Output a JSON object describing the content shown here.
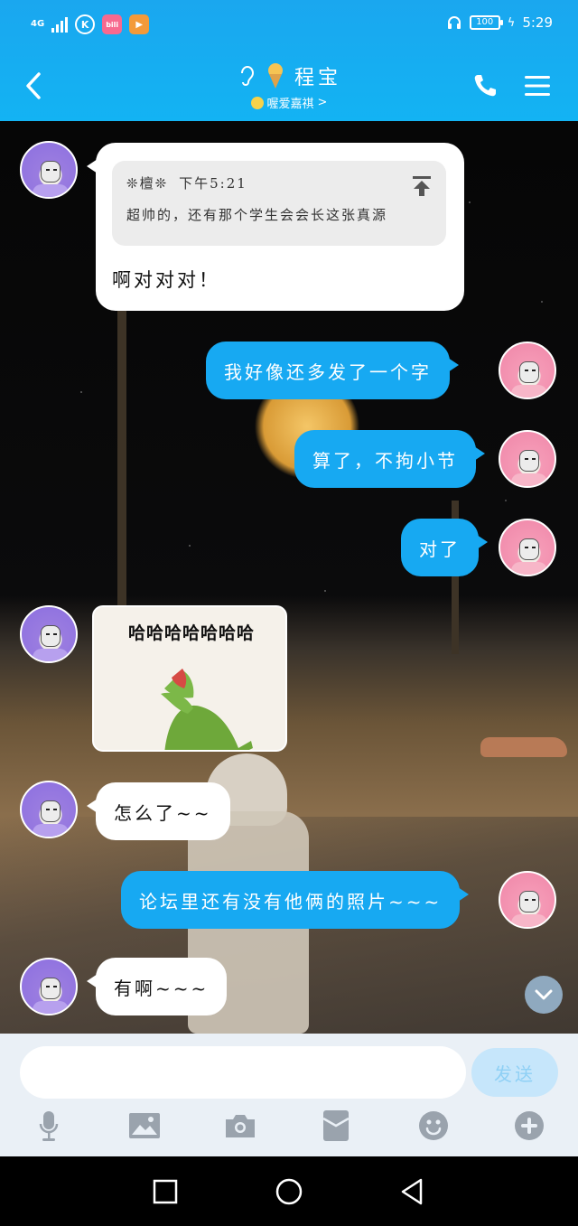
{
  "status_bar": {
    "network": "4G",
    "battery": "100",
    "time": "5:29",
    "apps": [
      "K",
      "bili",
      "▶"
    ]
  },
  "header": {
    "title": "程宝",
    "subtitle": "喔爱嘉祺",
    "subtitle_chevron": ">",
    "colors": {
      "bar": "#13b3f3",
      "bubble_out": "#17a9f2",
      "bubble_in": "#ffffff"
    },
    "icons": [
      "back-icon",
      "ear-icon",
      "ice-cream-icon",
      "phone-icon",
      "menu-icon"
    ]
  },
  "messages": [
    {
      "side": "in",
      "type": "reply",
      "quote": {
        "author": "❊檀❊",
        "time": "下午5:21",
        "text": "超帅的，还有那个学生会会长这张真源"
      },
      "text": "啊对对对！"
    },
    {
      "side": "out",
      "text": "我好像还多发了一个字"
    },
    {
      "side": "out",
      "text": "算了，不拘小节"
    },
    {
      "side": "out",
      "text": "对了"
    },
    {
      "side": "in",
      "type": "sticker",
      "caption": "哈哈哈哈哈哈哈"
    },
    {
      "side": "in",
      "text": "怎么了~~"
    },
    {
      "side": "out",
      "text": "论坛里还有没有他俩的照片~~~"
    },
    {
      "side": "in",
      "text": "有啊~~~"
    }
  ],
  "composer": {
    "input_value": "",
    "send_label": "发送",
    "tools": [
      "microphone-icon",
      "image-icon",
      "camera-icon",
      "red-packet-icon",
      "emoji-icon",
      "plus-icon"
    ]
  },
  "system_nav": [
    "square-icon",
    "circle-icon",
    "triangle-back-icon"
  ]
}
